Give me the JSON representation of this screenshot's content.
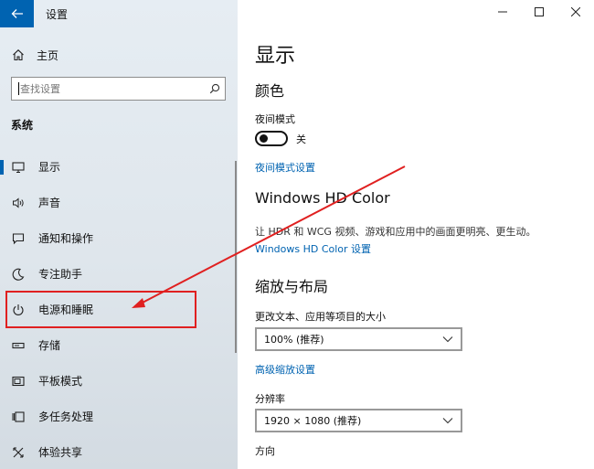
{
  "window": {
    "title": "设置",
    "controls": {
      "minimize": "—",
      "maximize": "☐",
      "close": "✕"
    }
  },
  "sidebar": {
    "home_label": "主页",
    "search": {
      "placeholder": "查找设置"
    },
    "section_heading": "系统",
    "items": [
      {
        "label": "显示",
        "icon": "monitor-icon",
        "active": true
      },
      {
        "label": "声音",
        "icon": "speaker-icon",
        "active": false
      },
      {
        "label": "通知和操作",
        "icon": "message-icon",
        "active": false
      },
      {
        "label": "专注助手",
        "icon": "moon-icon",
        "active": false
      },
      {
        "label": "电源和睡眠",
        "icon": "power-icon",
        "active": false
      },
      {
        "label": "存储",
        "icon": "storage-icon",
        "active": false
      },
      {
        "label": "平板模式",
        "icon": "tablet-icon",
        "active": false
      },
      {
        "label": "多任务处理",
        "icon": "multitask-icon",
        "active": false
      },
      {
        "label": "体验共享",
        "icon": "share-icon",
        "active": false
      }
    ]
  },
  "main": {
    "page_title": "显示",
    "color_heading": "颜色",
    "night_mode": {
      "label": "夜间模式",
      "state_label": "关",
      "settings_link": "夜间模式设置"
    },
    "hdr": {
      "heading": "Windows HD Color",
      "description": "让 HDR 和 WCG 视频、游戏和应用中的画面更明亮、更生动。",
      "settings_link": "Windows HD Color 设置"
    },
    "scale_layout": {
      "heading": "缩放与布局",
      "text_size_label": "更改文本、应用等项目的大小",
      "text_size_value": "100% (推荐)",
      "advanced_link": "高级缩放设置",
      "resolution_label": "分辨率",
      "resolution_value": "1920 × 1080 (推荐)",
      "orientation_label": "方向"
    }
  },
  "annotation": {
    "highlight_color": "#e02020"
  },
  "colors": {
    "accent": "#0063b1",
    "sidebar_bg": "#e2e9ef"
  }
}
